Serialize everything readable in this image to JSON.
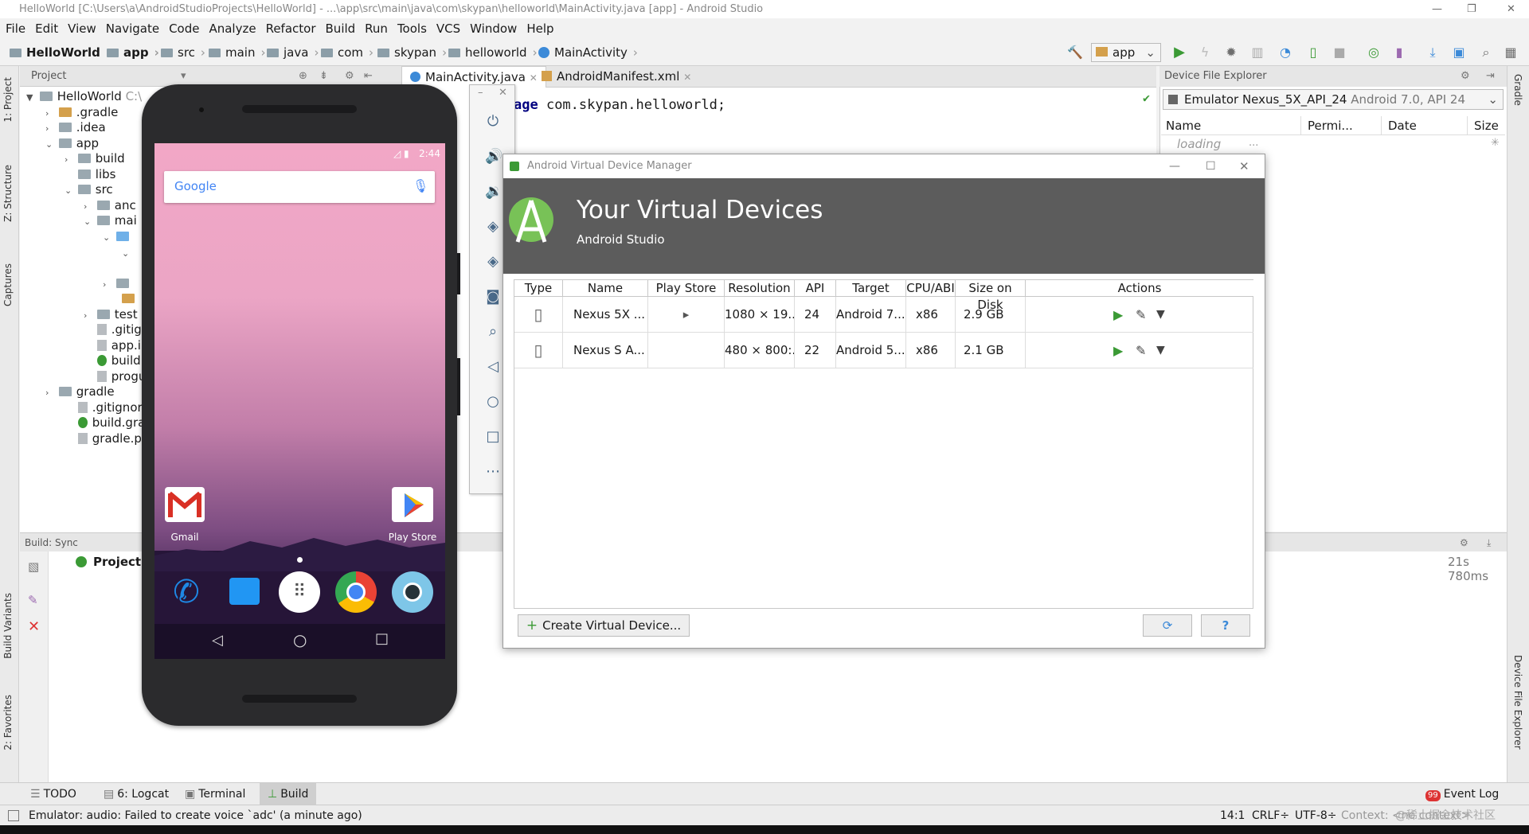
{
  "window": {
    "title": "HelloWorld [C:\\Users\\a\\AndroidStudioProjects\\HelloWorld] - ...\\app\\src\\main\\java\\com\\skypan\\helloworld\\MainActivity.java [app] - Android Studio"
  },
  "menu": [
    "File",
    "Edit",
    "View",
    "Navigate",
    "Code",
    "Analyze",
    "Refactor",
    "Build",
    "Run",
    "Tools",
    "VCS",
    "Window",
    "Help"
  ],
  "breadcrumb": [
    "HelloWorld",
    "app",
    "src",
    "main",
    "java",
    "com",
    "skypan",
    "helloworld",
    "MainActivity"
  ],
  "toolbar": {
    "run_config": "app"
  },
  "left_tabs": {
    "project": "1: Project",
    "structure": "Z: Structure",
    "captures": "Captures",
    "build_variants": "Build Variants",
    "favorites": "2: Favorites"
  },
  "right_tabs": {
    "gradle": "Gradle",
    "dfe": "Device File Explorer"
  },
  "project_panel": {
    "header": "Project",
    "root": "HelloWorld",
    "root_path": "C:\\",
    "items": [
      ".gradle",
      ".idea",
      "app",
      "build",
      "libs",
      "src",
      "anc",
      "mai",
      "test",
      ".gitignc",
      "app.iml",
      "build.g",
      "progua",
      "gradle",
      ".gitignore",
      "build.gradl",
      "gradle.prop"
    ]
  },
  "editor": {
    "tabs": [
      "MainActivity.java",
      "AndroidManifest.xml"
    ],
    "code_keyword": "age",
    "code_rest": " com.skypan.helloworld;"
  },
  "device_file_explorer": {
    "title": "Device File Explorer",
    "device": "Emulator Nexus_5X_API_24",
    "device_detail": "Android 7.0, API 24",
    "columns": [
      "Name",
      "Permi...",
      "Date",
      "Size"
    ],
    "loading": "loading",
    "loading_dots": "..."
  },
  "build_panel": {
    "title": "Build: Sync",
    "status": "Project se",
    "time": "21s 780ms"
  },
  "emulator": {
    "time": "2:44",
    "search_logo": "Google",
    "apps": [
      {
        "label": "Gmail"
      },
      {
        "label": "Play Store"
      }
    ]
  },
  "avd_manager": {
    "window_title": "Android Virtual Device Manager",
    "heading": "Your Virtual Devices",
    "subheading": "Android Studio",
    "columns": [
      "Type",
      "Name",
      "Play Store",
      "Resolution",
      "API",
      "Target",
      "CPU/ABI",
      "Size on Disk",
      "Actions"
    ],
    "rows": [
      {
        "name": "Nexus 5X ...",
        "resolution": "1080 × 19...",
        "api": "24",
        "target": "Android 7....",
        "cpu": "x86",
        "size": "2.9 GB"
      },
      {
        "name": "Nexus S A...",
        "resolution": "480 × 800:...",
        "api": "22",
        "target": "Android 5....",
        "cpu": "x86",
        "size": "2.1 GB"
      }
    ],
    "create_button": "Create Virtual Device...",
    "help_button": "?"
  },
  "bottom_tabs": [
    "TODO",
    "6: Logcat",
    "Terminal",
    "Build"
  ],
  "event_log": "Event Log",
  "status": {
    "message": "Emulator: audio: Failed to create voice `adc' (a minute ago)",
    "position": "14:1",
    "line_sep": "CRLF÷",
    "encoding": "UTF-8÷",
    "context": "Context: <no context>",
    "watermark": "@稀土掘金技术社区"
  },
  "colors": {
    "accent": "#3c8ad8",
    "green": "#3b9a35",
    "banner": "#5c5c5c"
  }
}
